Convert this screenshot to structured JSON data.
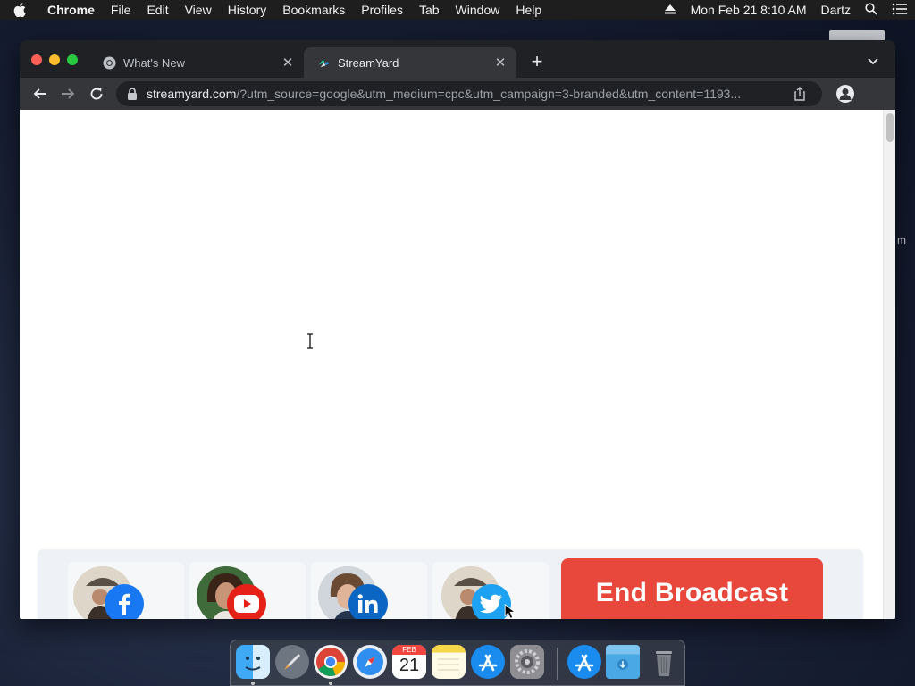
{
  "menubar": {
    "app_name": "Chrome",
    "items": [
      "File",
      "Edit",
      "View",
      "History",
      "Bookmarks",
      "Profiles",
      "Tab",
      "Window",
      "Help"
    ],
    "clock": "Mon Feb 21  8:10 AM",
    "user": "Dartz"
  },
  "desktop": {
    "side_label": "m"
  },
  "browser": {
    "tabs": [
      {
        "title": "What's New",
        "icon": "chrome-icon",
        "active": false
      },
      {
        "title": "StreamYard",
        "icon": "streamyard-icon",
        "active": true
      }
    ],
    "address": {
      "host": "streamyard.com",
      "rest": "/?utm_source=google&utm_medium=cpc&utm_campaign=3-branded&utm_content=1193..."
    }
  },
  "page": {
    "destinations": [
      {
        "platform": "facebook",
        "icon": "facebook-icon",
        "color": "#1877f2"
      },
      {
        "platform": "youtube",
        "icon": "youtube-icon",
        "color": "#e62117"
      },
      {
        "platform": "linkedin",
        "icon": "linkedin-icon",
        "color": "#0a66c2"
      },
      {
        "platform": "twitter",
        "icon": "twitter-icon",
        "color": "#1da1f2"
      }
    ],
    "end_broadcast_label": "End Broadcast",
    "end_broadcast_color": "#e8473b"
  },
  "dock": {
    "apps": [
      "finder-icon",
      "launchpad-icon",
      "chrome-icon",
      "safari-icon",
      "calendar-icon",
      "notes-icon",
      "app-store-icon",
      "system-preferences-icon",
      "downloads-icon",
      "folder-icon",
      "trash-icon"
    ],
    "calendar": {
      "month": "FEB",
      "day": "21"
    }
  }
}
